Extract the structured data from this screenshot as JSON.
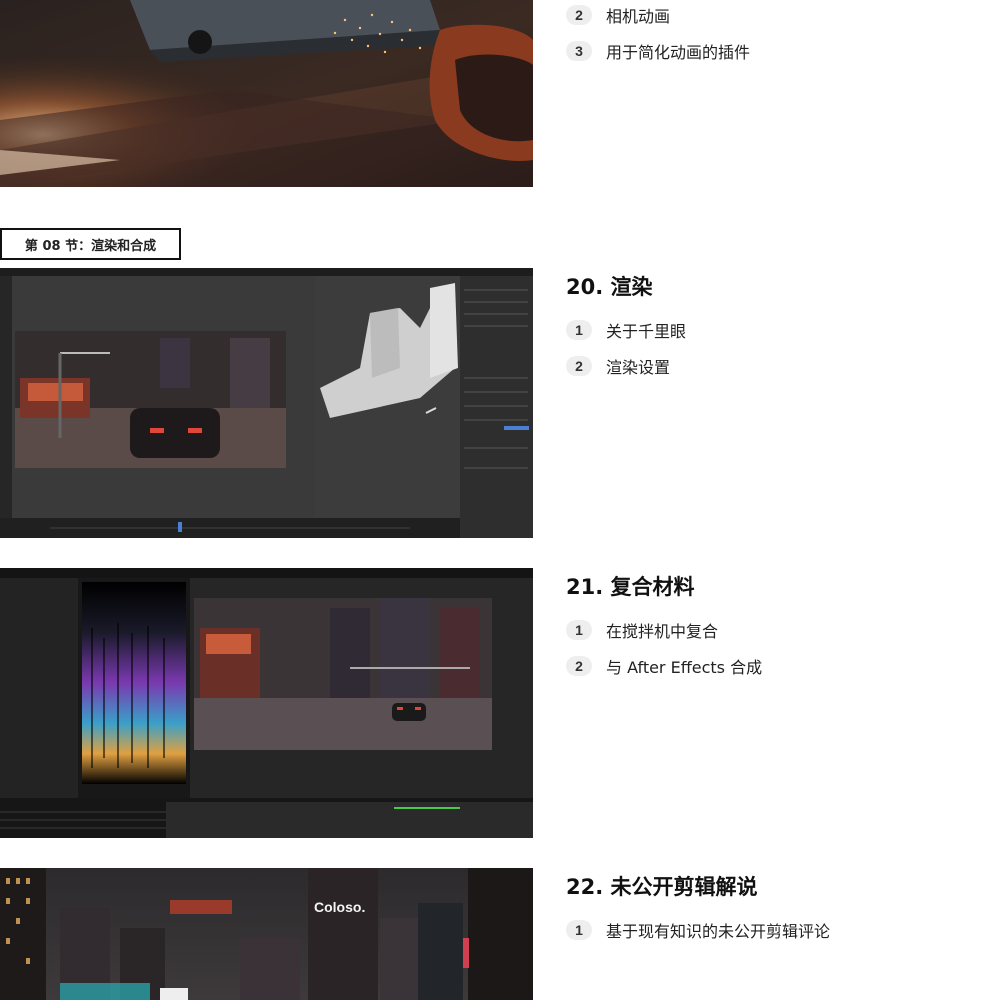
{
  "top_block": {
    "items": [
      {
        "num": "2",
        "label": "相机动画"
      },
      {
        "num": "3",
        "label": "用于简化动画的插件"
      }
    ]
  },
  "section": {
    "label": "第 08 节：渲染和合成"
  },
  "lessons": [
    {
      "title": "20. 渲染",
      "items": [
        {
          "num": "1",
          "label": "关于千里眼"
        },
        {
          "num": "2",
          "label": "渲染设置"
        }
      ]
    },
    {
      "title": "21. 复合材料",
      "items": [
        {
          "num": "1",
          "label": "在搅拌机中复合"
        },
        {
          "num": "2",
          "label": "与 After Effects 合成"
        }
      ]
    },
    {
      "title": "22. 未公开剪辑解说",
      "items": [
        {
          "num": "1",
          "label": "基于现有知识的未公开剪辑评论"
        }
      ]
    }
  ],
  "images": {
    "city_sign": "Coloso."
  }
}
